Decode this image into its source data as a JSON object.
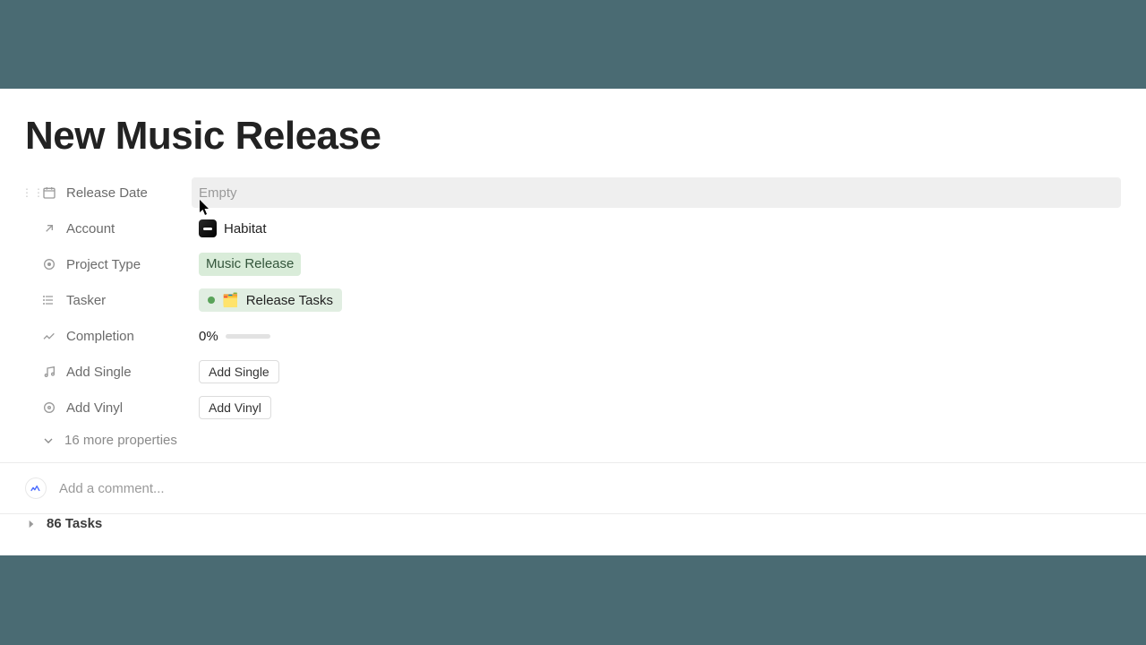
{
  "title": "New Music Release",
  "props": {
    "release_date": {
      "label": "Release Date",
      "value": "Empty"
    },
    "account": {
      "label": "Account",
      "value": "Habitat"
    },
    "project_type": {
      "label": "Project Type",
      "value": "Music Release"
    },
    "tasker": {
      "label": "Tasker",
      "value": "Release Tasks",
      "emoji": "🗂️"
    },
    "completion": {
      "label": "Completion",
      "value": "0%"
    },
    "add_single": {
      "label": "Add Single",
      "button": "Add Single"
    },
    "add_vinyl": {
      "label": "Add Vinyl",
      "button": "Add Vinyl"
    }
  },
  "more_properties_label": "16 more properties",
  "comment_placeholder": "Add a comment...",
  "tasks_heading": "86 Tasks"
}
